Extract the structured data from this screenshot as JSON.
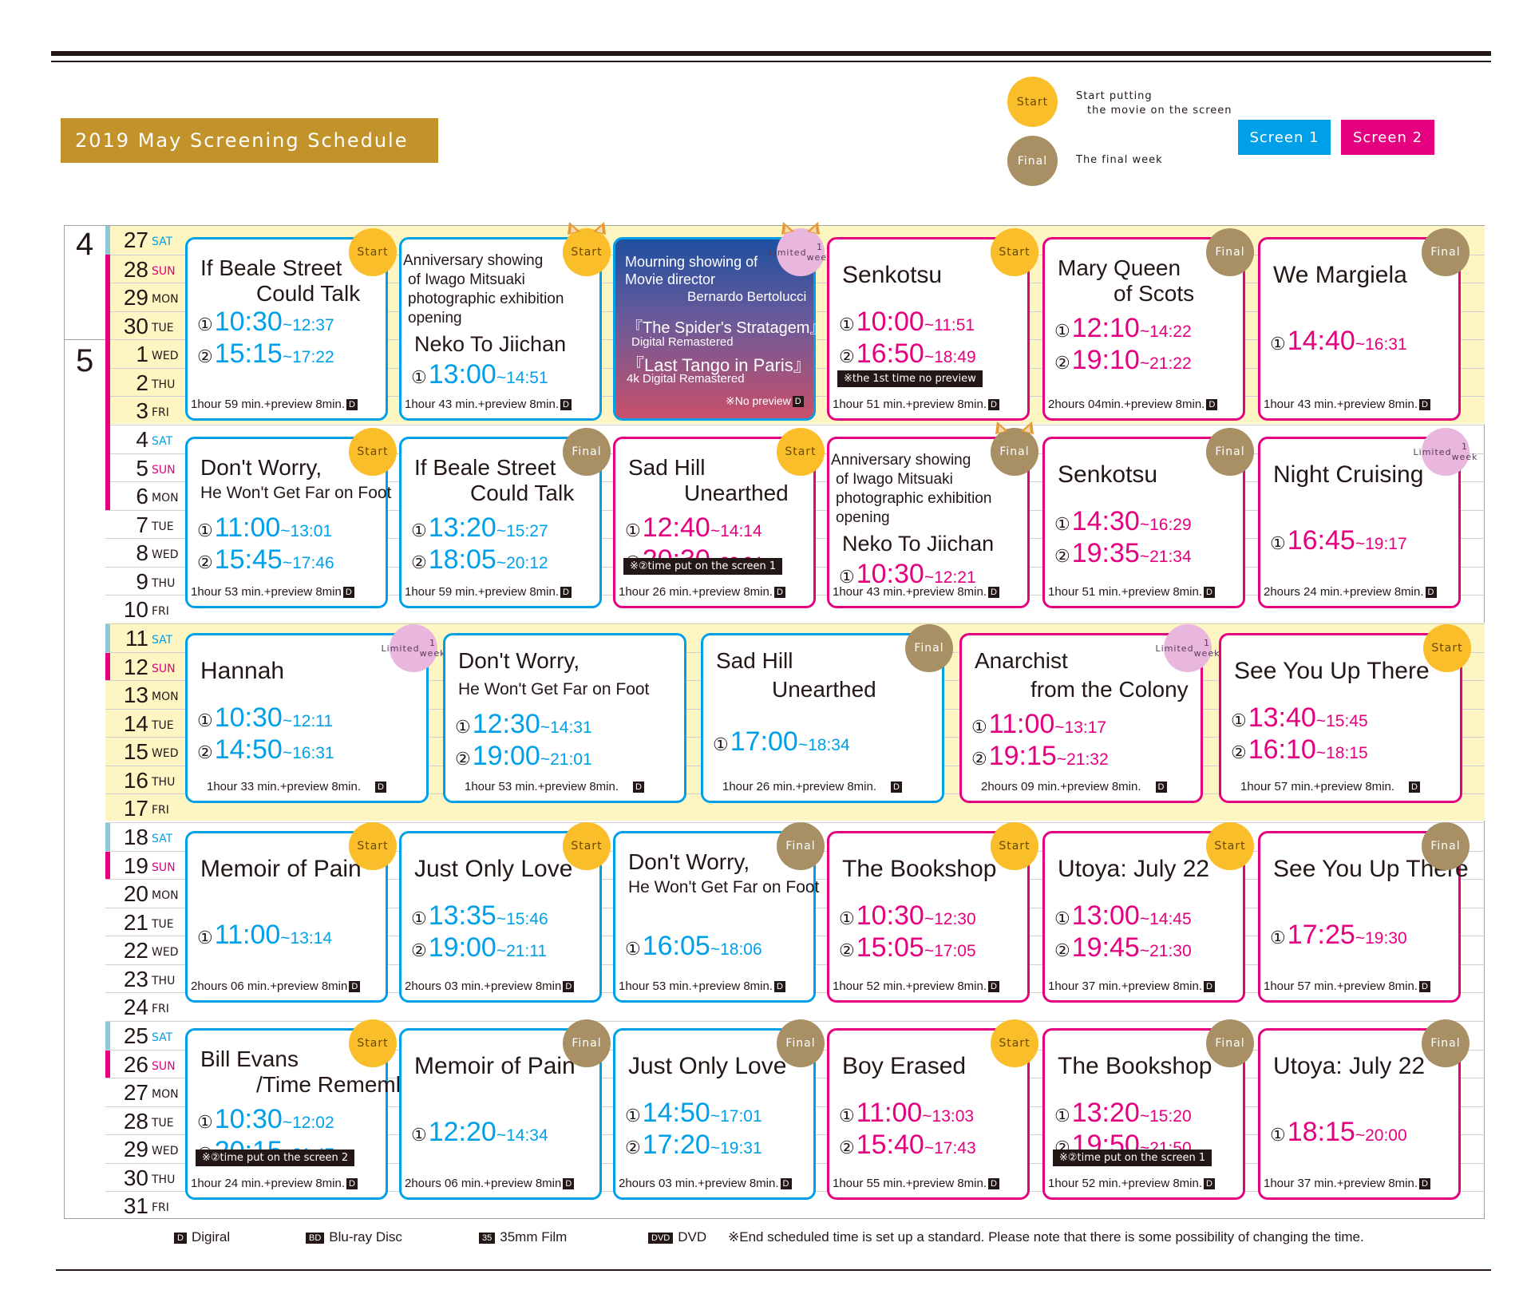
{
  "title": "2019 May Screening Schedule",
  "legend": {
    "start_badge": "Start",
    "start_text_1": "Start putting",
    "start_text_2": "the movie on the screen",
    "final_badge": "Final",
    "final_text": "The final week",
    "screen1": "Screen 1",
    "screen2": "Screen 2"
  },
  "colors": {
    "screen1": "#00a0e9",
    "screen2": "#e4007f",
    "start": "#f9be2a",
    "final": "#a89064",
    "limited": "#e9b7dd",
    "title_bg": "#c2922b",
    "weekend_band": "#fdf6c3"
  },
  "months": {
    "april": "4",
    "may": "5"
  },
  "days": [
    {
      "n": "27",
      "d": "SAT"
    },
    {
      "n": "28",
      "d": "SUN"
    },
    {
      "n": "29",
      "d": "MON"
    },
    {
      "n": "30",
      "d": "TUE"
    },
    {
      "n": "1",
      "d": "WED"
    },
    {
      "n": "2",
      "d": "THU"
    },
    {
      "n": "3",
      "d": "FRI"
    },
    {
      "n": "4",
      "d": "SAT"
    },
    {
      "n": "5",
      "d": "SUN"
    },
    {
      "n": "6",
      "d": "MON"
    },
    {
      "n": "7",
      "d": "TUE"
    },
    {
      "n": "8",
      "d": "WED"
    },
    {
      "n": "9",
      "d": "THU"
    },
    {
      "n": "10",
      "d": "FRI"
    },
    {
      "n": "11",
      "d": "SAT"
    },
    {
      "n": "12",
      "d": "SUN"
    },
    {
      "n": "13",
      "d": "MON"
    },
    {
      "n": "14",
      "d": "TUE"
    },
    {
      "n": "15",
      "d": "WED"
    },
    {
      "n": "16",
      "d": "THU"
    },
    {
      "n": "17",
      "d": "FRI"
    },
    {
      "n": "18",
      "d": "SAT"
    },
    {
      "n": "19",
      "d": "SUN"
    },
    {
      "n": "20",
      "d": "MON"
    },
    {
      "n": "21",
      "d": "TUE"
    },
    {
      "n": "22",
      "d": "WED"
    },
    {
      "n": "23",
      "d": "THU"
    },
    {
      "n": "24",
      "d": "FRI"
    },
    {
      "n": "25",
      "d": "SAT"
    },
    {
      "n": "26",
      "d": "SUN"
    },
    {
      "n": "27",
      "d": "MON"
    },
    {
      "n": "28",
      "d": "TUE"
    },
    {
      "n": "29",
      "d": "WED"
    },
    {
      "n": "30",
      "d": "THU"
    },
    {
      "n": "31",
      "d": "FRI"
    }
  ],
  "badges": {
    "start": "Start",
    "final": "Final",
    "limited_1": "Limited",
    "limited_2": "1 week"
  },
  "d_mark": "D",
  "no_preview": "※No preview",
  "cards": {
    "w1": [
      {
        "t1": "If Beale Street",
        "t2": "Could Talk",
        "a": "10:30",
        "ae": "~12:37",
        "b": "15:15",
        "be": "~17:22",
        "rt": "1hour 59 min.+preview 8min."
      },
      {
        "t1": "Anniversary showing",
        "t2": "of Iwago Mitsuaki",
        "t3": "photographic exhibition",
        "t4": "opening",
        "t5": "Neko To Jiichan",
        "a": "13:00",
        "ae": "~14:51",
        "rt": "1hour 43 min.+preview 8min."
      },
      {
        "t1": "Mourning showing of",
        "t2": "Movie director",
        "t3": "Bernardo Bertolucci",
        "t4": "『The Spider's Stratagem』",
        "t5": "Digital Remastered",
        "t6": "『Last Tango in Paris』",
        "t7": "4k Digital Remastered"
      },
      {
        "t1": "Senkotsu",
        "a": "10:00",
        "ae": "~11:51",
        "b": "16:50",
        "be": "~18:49",
        "note": "※the 1st time no preview",
        "rt": "1hour 51 min.+preview 8min."
      },
      {
        "t1": "Mary Queen",
        "t2": "of Scots",
        "a": "12:10",
        "ae": "~14:22",
        "b": "19:10",
        "be": "~21:22",
        "rt": "2hours 04min.+preview 8min."
      },
      {
        "t1": "We Margiela",
        "a": "14:40",
        "ae": "~16:31",
        "rt": "1hour 43 min.+preview 8min."
      }
    ],
    "w2": [
      {
        "t1": "Don't Worry,",
        "t2": "He Won't Get Far on Foot",
        "a": "11:00",
        "ae": "~13:01",
        "b": "15:45",
        "be": "~17:46",
        "rt": "1hour 53 min.+preview 8min"
      },
      {
        "t1": "If Beale Street",
        "t2": "Could Talk",
        "a": "13:20",
        "ae": "~15:27",
        "b": "18:05",
        "be": "~20:12",
        "rt": "1hour 59 min.+preview 8min."
      },
      {
        "t1": "Sad Hill",
        "t2": "Unearthed",
        "a": "12:40",
        "ae": "~14:14",
        "b": "20:30",
        "be": "~22:04",
        "note": "※②time put on the screen 1",
        "rt": "1hour 26 min.+preview 8min."
      },
      {
        "t1": "Anniversary showing",
        "t2": "of Iwago Mitsuaki",
        "t3": "photographic exhibition",
        "t4": "opening",
        "t5": "Neko To Jiichan",
        "a": "10:30",
        "ae": "~12:21",
        "rt": "1hour 43 min.+preview 8min."
      },
      {
        "t1": "Senkotsu",
        "a": "14:30",
        "ae": "~16:29",
        "b": "19:35",
        "be": "~21:34",
        "rt": "1hour 51 min.+preview 8min."
      },
      {
        "t1": "Night Cruising",
        "a": "16:45",
        "ae": "~19:17",
        "rt": "2hours 24 min.+preview 8min."
      }
    ],
    "w3": [
      {
        "t1": "Hannah",
        "a": "10:30",
        "ae": "~12:11",
        "b": "14:50",
        "be": "~16:31",
        "rt": "1hour 33 min.+preview 8min."
      },
      {
        "t1": "Don't Worry,",
        "t2": "He Won't Get Far on Foot",
        "a": "12:30",
        "ae": "~14:31",
        "b": "19:00",
        "be": "~21:01",
        "rt": "1hour 53 min.+preview 8min."
      },
      {
        "t1": "Sad Hill",
        "t2": "Unearthed",
        "a": "17:00",
        "ae": "~18:34",
        "rt": "1hour 26 min.+preview 8min."
      },
      {
        "t1": "Anarchist",
        "t2": "from the Colony",
        "a": "11:00",
        "ae": "~13:17",
        "b": "19:15",
        "be": "~21:32",
        "rt": "2hours 09 min.+preview 8min."
      },
      {
        "t1": "See You Up There",
        "a": "13:40",
        "ae": "~15:45",
        "b": "16:10",
        "be": "~18:15",
        "rt": "1hour 57 min.+preview 8min."
      }
    ],
    "w4": [
      {
        "t1": "Memoir of Pain",
        "a": "11:00",
        "ae": "~13:14",
        "rt": "2hours 06 min.+preview 8min"
      },
      {
        "t1": "Just Only Love",
        "a": "13:35",
        "ae": "~15:46",
        "b": "19:00",
        "be": "~21:11",
        "rt": "2hours 03 min.+preview 8min"
      },
      {
        "t1": "Don't Worry,",
        "t2": "He Won't Get Far on Foot",
        "a": "16:05",
        "ae": "~18:06",
        "rt": "1hour 53 min.+preview 8min."
      },
      {
        "t1": "The Bookshop",
        "a": "10:30",
        "ae": "~12:30",
        "b": "15:05",
        "be": "~17:05",
        "rt": "1hour 52 min.+preview 8min."
      },
      {
        "t1": "Utoya: July 22",
        "a": "13:00",
        "ae": "~14:45",
        "b": "19:45",
        "be": "~21:30",
        "rt": "1hour 37 min.+preview 8min."
      },
      {
        "t1": "See You Up There",
        "a": "17:25",
        "ae": "~19:30",
        "rt": "1hour 57 min.+preview 8min."
      }
    ],
    "w5": [
      {
        "t1": "Bill Evans",
        "t2": "/Time Remembered",
        "a": "10:30",
        "ae": "~12:02",
        "b": "20:15",
        "be": "~21:47",
        "note": "※②time put on the screen 2",
        "rt": "1hour 24 min.+preview 8min."
      },
      {
        "t1": "Memoir of Pain",
        "a": "12:20",
        "ae": "~14:34",
        "rt": "2hours 06 min.+preview 8min"
      },
      {
        "t1": "Just Only Love",
        "a": "14:50",
        "ae": "~17:01",
        "b": "17:20",
        "be": "~19:31",
        "rt": "2hours 03 min.+preview 8min."
      },
      {
        "t1": "Boy Erased",
        "a": "11:00",
        "ae": "~13:03",
        "b": "15:40",
        "be": "~17:43",
        "rt": "1hour 55 min.+preview 8min."
      },
      {
        "t1": "The Bookshop",
        "a": "13:20",
        "ae": "~15:20",
        "b": "19:50",
        "be": "~21:50",
        "note": "※②time put on the screen 1",
        "rt": "1hour 52 min.+preview 8min."
      },
      {
        "t1": "Utoya: July 22",
        "a": "18:15",
        "ae": "~20:00",
        "rt": "1hour 37 min.+preview 8min."
      }
    ]
  },
  "footer": {
    "digital_mark": "D",
    "digital": "Digiral",
    "bluray_mark": "BD",
    "bluray": "Blu-ray Disc",
    "film_mark": "35",
    "film": "35mm Film",
    "dvd_mark": "DVD",
    "dvd": "DVD",
    "note": "※End scheduled time is set up a standard. Please note that there is some possibility of changing the time."
  }
}
